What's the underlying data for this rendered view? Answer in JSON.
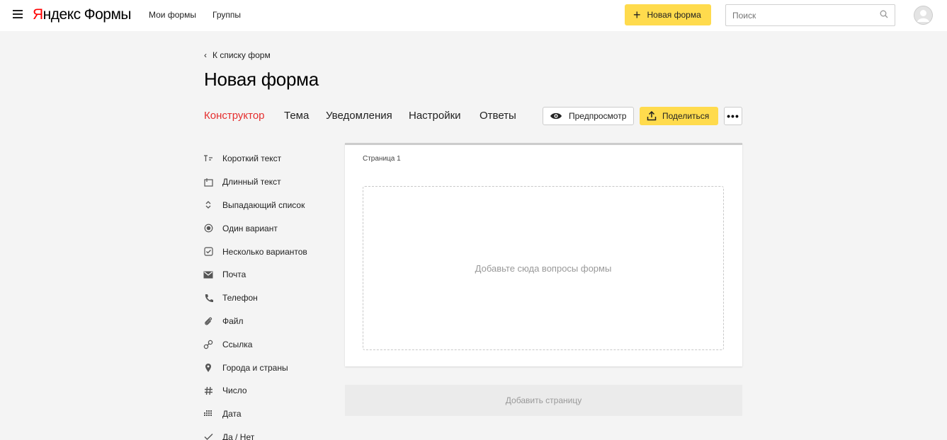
{
  "header": {
    "logo_yandex_first": "Я",
    "logo_yandex_rest": "ндекс",
    "logo_product": "Формы",
    "nav": [
      {
        "label": "Мои формы"
      },
      {
        "label": "Группы"
      }
    ],
    "new_form_label": "Новая форма",
    "search_placeholder": "Поиск"
  },
  "page": {
    "back_label": "К списку форм",
    "title": "Новая форма",
    "tabs": [
      {
        "label": "Конструктор",
        "active": true
      },
      {
        "label": "Тема"
      },
      {
        "label": "Уведомления"
      },
      {
        "label": "Настройки"
      },
      {
        "label": "Ответы"
      }
    ],
    "preview_label": "Предпросмотр",
    "share_label": "Поделиться",
    "more_label": "•••"
  },
  "sidebar": {
    "items": [
      {
        "label": "Короткий текст",
        "icon": "short-text-icon"
      },
      {
        "label": "Длинный текст",
        "icon": "long-text-icon"
      },
      {
        "label": "Выпадающий список",
        "icon": "dropdown-icon"
      },
      {
        "label": "Один вариант",
        "icon": "radio-icon"
      },
      {
        "label": "Несколько вариантов",
        "icon": "checkbox-icon"
      },
      {
        "label": "Почта",
        "icon": "mail-icon"
      },
      {
        "label": "Телефон",
        "icon": "phone-icon"
      },
      {
        "label": "Файл",
        "icon": "paperclip-icon"
      },
      {
        "label": "Ссылка",
        "icon": "link-icon"
      },
      {
        "label": "Города и страны",
        "icon": "location-pin-icon"
      },
      {
        "label": "Число",
        "icon": "hash-icon"
      },
      {
        "label": "Дата",
        "icon": "calendar-grid-icon"
      },
      {
        "label": "Да / Нет",
        "icon": "checkmark-icon"
      }
    ]
  },
  "form": {
    "page_label": "Страница 1",
    "dropzone_text": "Добавьте сюда вопросы формы",
    "add_page_label": "Добавить страницу"
  },
  "colors": {
    "accent_yellow": "#ffdb4d",
    "active_tab": "#e52e2e",
    "logo_red": "#ff0000"
  }
}
